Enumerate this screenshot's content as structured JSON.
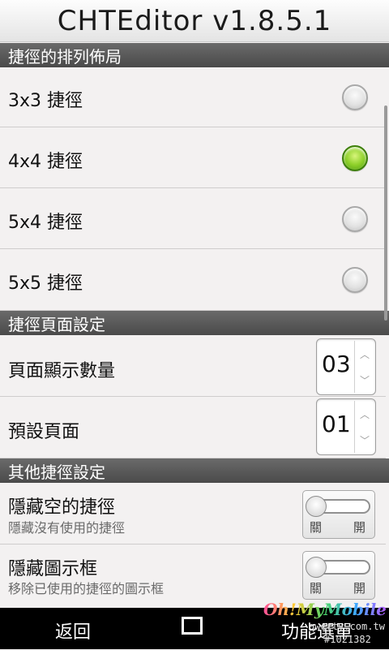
{
  "app": {
    "title": "CHTEditor v1.8.5.1"
  },
  "sections": {
    "layout": "捷徑的排列佈局",
    "page": "捷徑頁面設定",
    "other": "其他捷徑設定"
  },
  "layout_options": [
    {
      "label": "3x3 捷徑",
      "selected": false
    },
    {
      "label": "4x4 捷徑",
      "selected": true
    },
    {
      "label": "5x4 捷徑",
      "selected": false
    },
    {
      "label": "5x5 捷徑",
      "selected": false
    }
  ],
  "page_settings": {
    "count_label": "頁面顯示數量",
    "count_value": "03",
    "default_label": "預設頁面",
    "default_value": "01"
  },
  "other_settings": [
    {
      "title": "隱藏空的捷徑",
      "subtitle": "隱藏沒有使用的捷徑",
      "off_label": "關",
      "on_label": "開",
      "enabled": false
    },
    {
      "title": "隱藏圖示框",
      "subtitle": "移除已使用的捷徑的圖示框",
      "off_label": "關",
      "on_label": "開",
      "enabled": false
    }
  ],
  "navbar": {
    "back": "返回",
    "menu": "功能選單"
  },
  "watermark": {
    "brand": "Oh!MyMobile",
    "url": "qwerty.com.tw",
    "id": "#1021382"
  },
  "colors": {
    "selected_radio": "#8fd12b",
    "section_header": "#555555",
    "navbar": "#000000"
  }
}
